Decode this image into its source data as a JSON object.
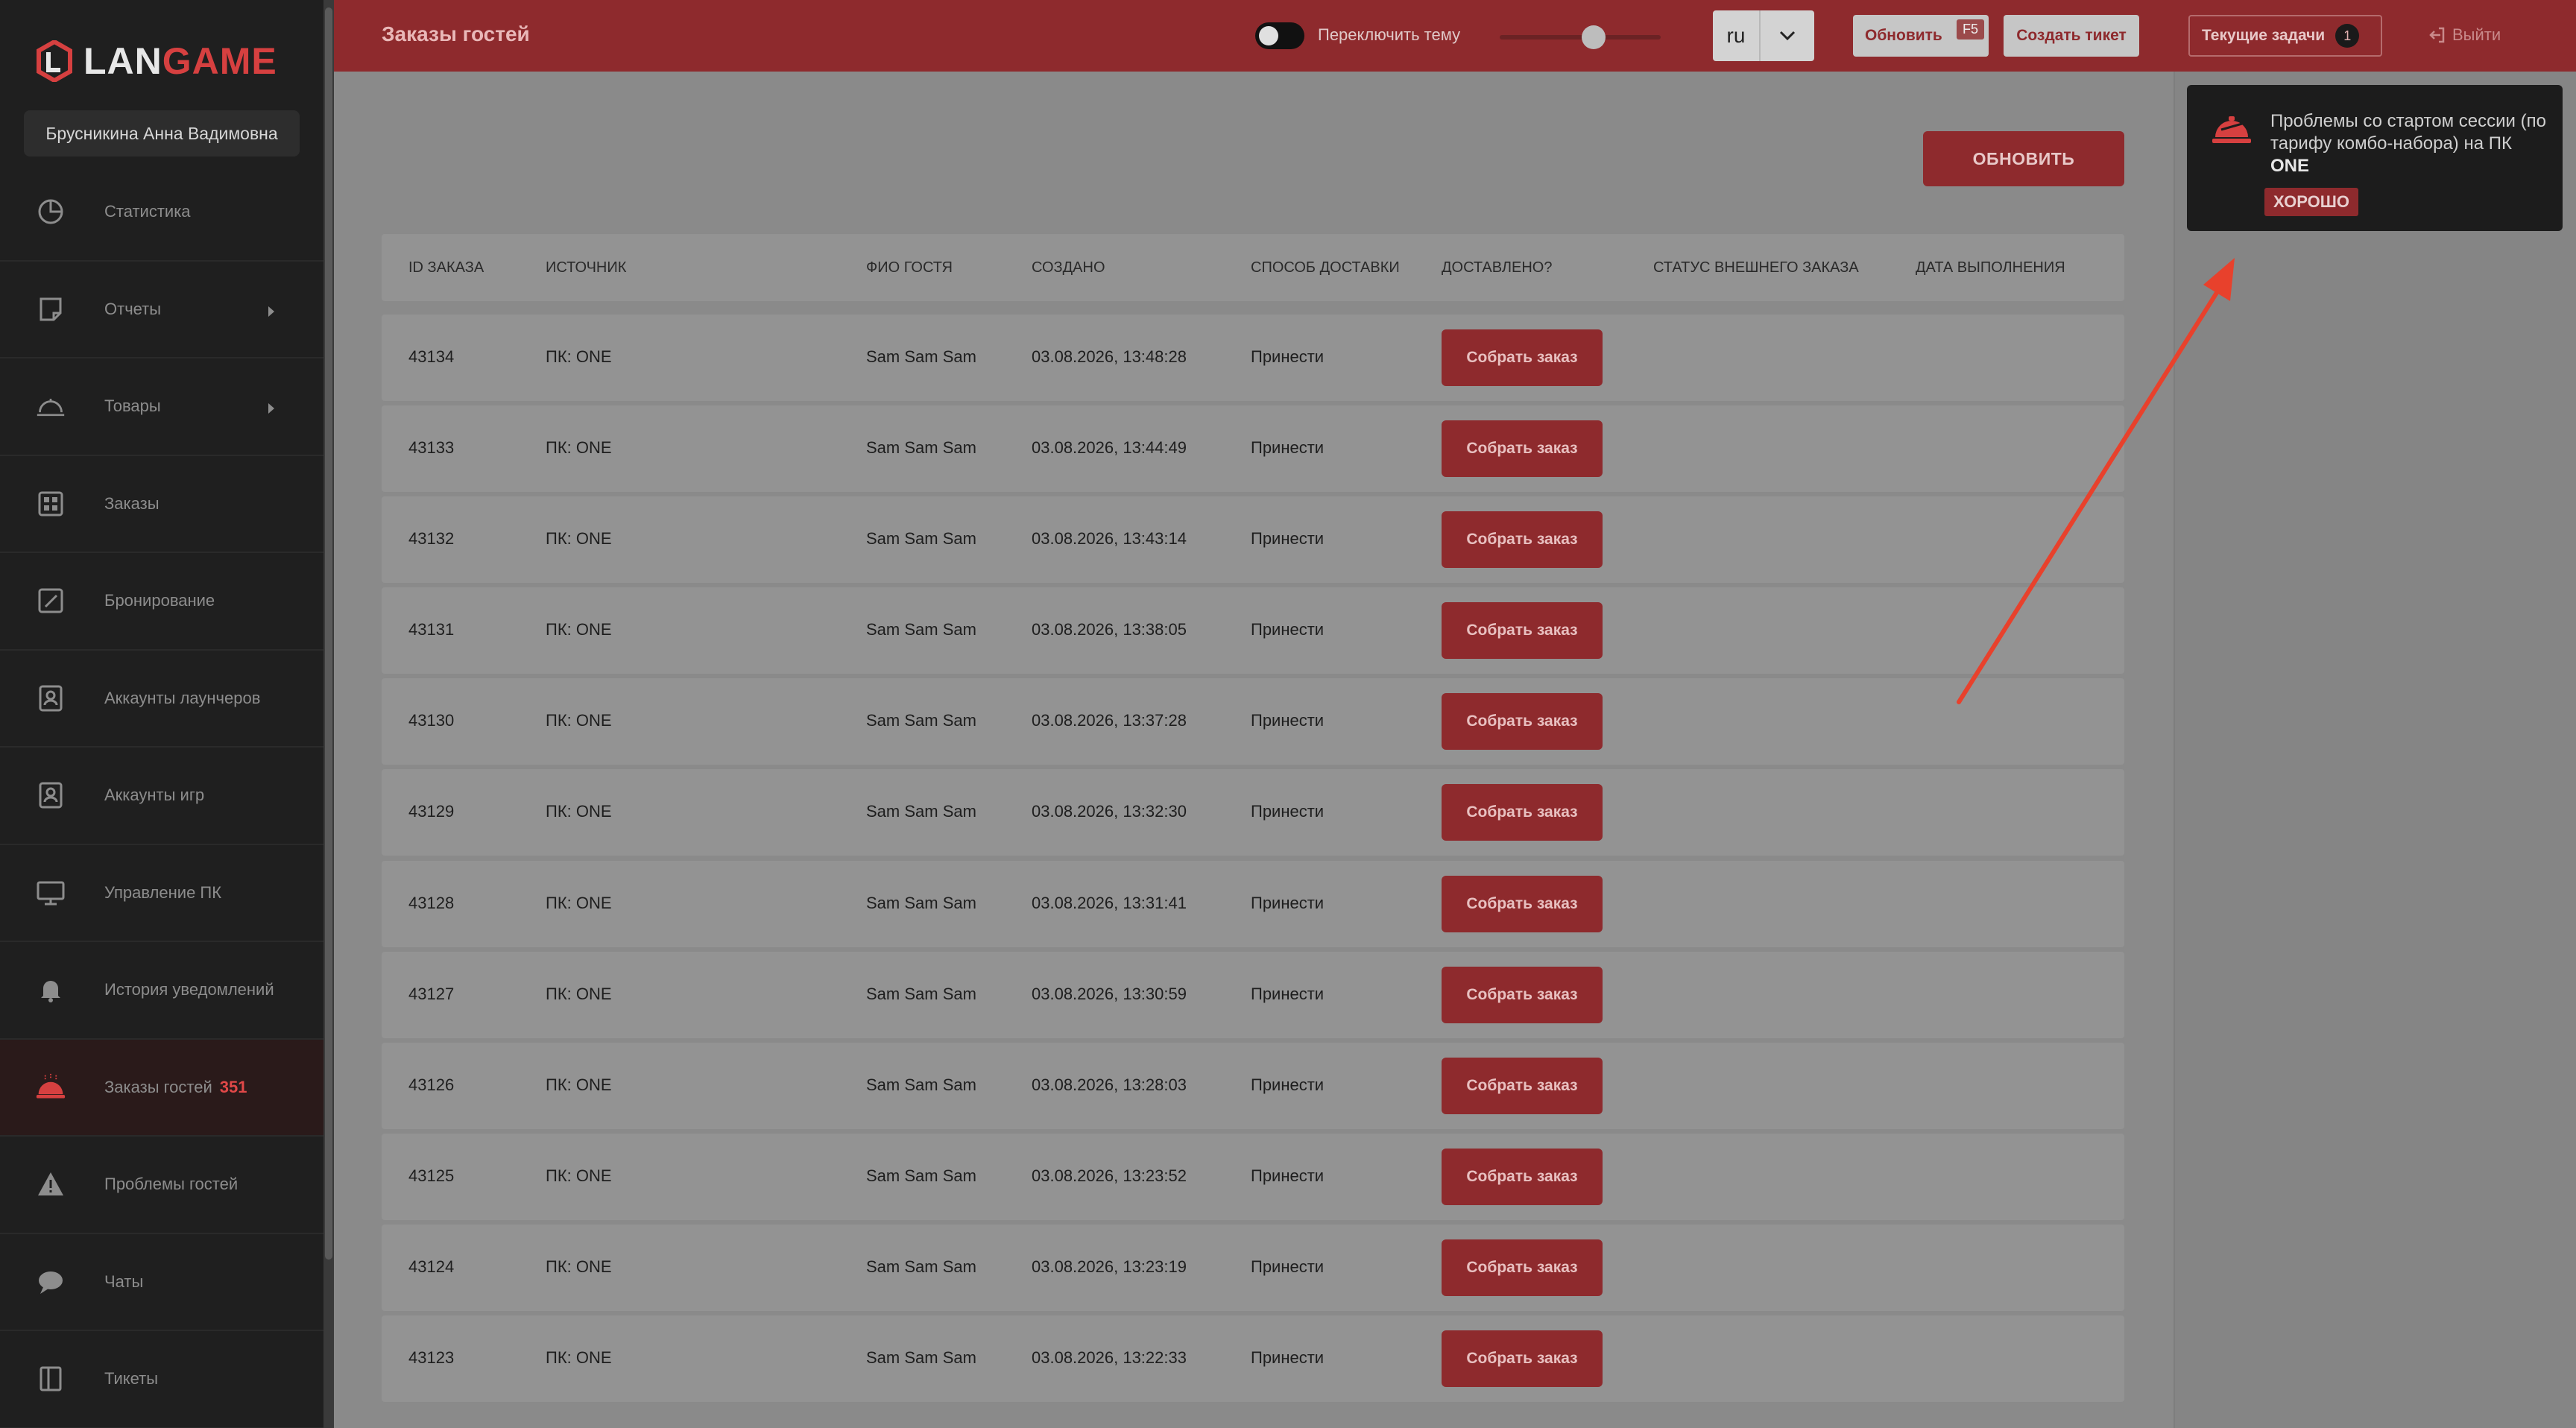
{
  "sidebar": {
    "logo": {
      "text_red": "L",
      "text_white": "AN",
      "text_red2": "GAME"
    },
    "user_name": "Брусникина Анна Вадимовна",
    "items": [
      {
        "label": "Статистика",
        "icon": "pie-chart-icon",
        "arrow": false
      },
      {
        "label": "Отчеты",
        "icon": "report-icon",
        "arrow": true
      },
      {
        "label": "Товары",
        "icon": "cloche-icon",
        "arrow": true
      },
      {
        "label": "Заказы",
        "icon": "grid-icon",
        "arrow": false
      },
      {
        "label": "Бронирование",
        "icon": "edit-icon",
        "arrow": false
      },
      {
        "label": "Аккаунты лаунчеров",
        "icon": "account-icon",
        "arrow": false
      },
      {
        "label": "Аккаунты игр",
        "icon": "account-icon",
        "arrow": false
      },
      {
        "label": "Управление ПК",
        "icon": "monitor-icon",
        "arrow": false
      },
      {
        "label": "История уведомлений",
        "icon": "bell-icon",
        "arrow": false
      },
      {
        "label": "Заказы гостей",
        "icon": "guest-order-icon",
        "arrow": false,
        "badge": "351",
        "active": true
      },
      {
        "label": "Проблемы гостей",
        "icon": "warning-icon",
        "arrow": false
      },
      {
        "label": "Чаты",
        "icon": "chat-icon",
        "arrow": false
      },
      {
        "label": "Тикеты",
        "icon": "ticket-icon",
        "arrow": false
      }
    ]
  },
  "topbar": {
    "title": "Заказы гостей",
    "theme_toggle_label": "Переключить тему",
    "lang": "ru",
    "refresh_label": "Обновить",
    "refresh_key": "F5",
    "ticket_label": "Создать тикет",
    "tasks_label": "Текущие задачи",
    "tasks_count": "1",
    "logout_label": "Выйти"
  },
  "main": {
    "refresh_button": "ОБНОВИТЬ",
    "columns": [
      "ID ЗАКАЗА",
      "ИСТОЧНИК",
      "ФИО ГОСТЯ",
      "СОЗДАНО",
      "СПОСОБ ДОСТАВКИ",
      "ДОСТАВЛЕНО?",
      "СТАТУС ВНЕШНЕГО ЗАКАЗА",
      "ДАТА ВЫПОЛНЕНИЯ"
    ],
    "action_label": "Собрать заказ",
    "rows": [
      {
        "id": "43134",
        "source": "ПК: ONE",
        "guest": "Sam Sam Sam",
        "created": "03.08.2026, 13:48:28",
        "delivery": "Принести"
      },
      {
        "id": "43133",
        "source": "ПК: ONE",
        "guest": "Sam Sam Sam",
        "created": "03.08.2026, 13:44:49",
        "delivery": "Принести"
      },
      {
        "id": "43132",
        "source": "ПК: ONE",
        "guest": "Sam Sam Sam",
        "created": "03.08.2026, 13:43:14",
        "delivery": "Принести"
      },
      {
        "id": "43131",
        "source": "ПК: ONE",
        "guest": "Sam Sam Sam",
        "created": "03.08.2026, 13:38:05",
        "delivery": "Принести"
      },
      {
        "id": "43130",
        "source": "ПК: ONE",
        "guest": "Sam Sam Sam",
        "created": "03.08.2026, 13:37:28",
        "delivery": "Принести"
      },
      {
        "id": "43129",
        "source": "ПК: ONE",
        "guest": "Sam Sam Sam",
        "created": "03.08.2026, 13:32:30",
        "delivery": "Принести"
      },
      {
        "id": "43128",
        "source": "ПК: ONE",
        "guest": "Sam Sam Sam",
        "created": "03.08.2026, 13:31:41",
        "delivery": "Принести"
      },
      {
        "id": "43127",
        "source": "ПК: ONE",
        "guest": "Sam Sam Sam",
        "created": "03.08.2026, 13:30:59",
        "delivery": "Принести"
      },
      {
        "id": "43126",
        "source": "ПК: ONE",
        "guest": "Sam Sam Sam",
        "created": "03.08.2026, 13:28:03",
        "delivery": "Принести"
      },
      {
        "id": "43125",
        "source": "ПК: ONE",
        "guest": "Sam Sam Sam",
        "created": "03.08.2026, 13:23:52",
        "delivery": "Принести"
      },
      {
        "id": "43124",
        "source": "ПК: ONE",
        "guest": "Sam Sam Sam",
        "created": "03.08.2026, 13:23:19",
        "delivery": "Принести"
      },
      {
        "id": "43123",
        "source": "ПК: ONE",
        "guest": "Sam Sam Sam",
        "created": "03.08.2026, 13:22:33",
        "delivery": "Принести"
      }
    ]
  },
  "toast": {
    "message_prefix": "Проблемы со стартом сессии (по тарифу комбо-набора) на ПК ",
    "message_bold": "ONE",
    "ok_label": "ХОРОШО",
    "icon": "guest-order-icon"
  },
  "colors": {
    "brand_red": "#8e2a2d",
    "accent_red": "#d64040",
    "sidebar_bg": "#1f1f1f",
    "annotation_arrow": "#e8412c"
  }
}
